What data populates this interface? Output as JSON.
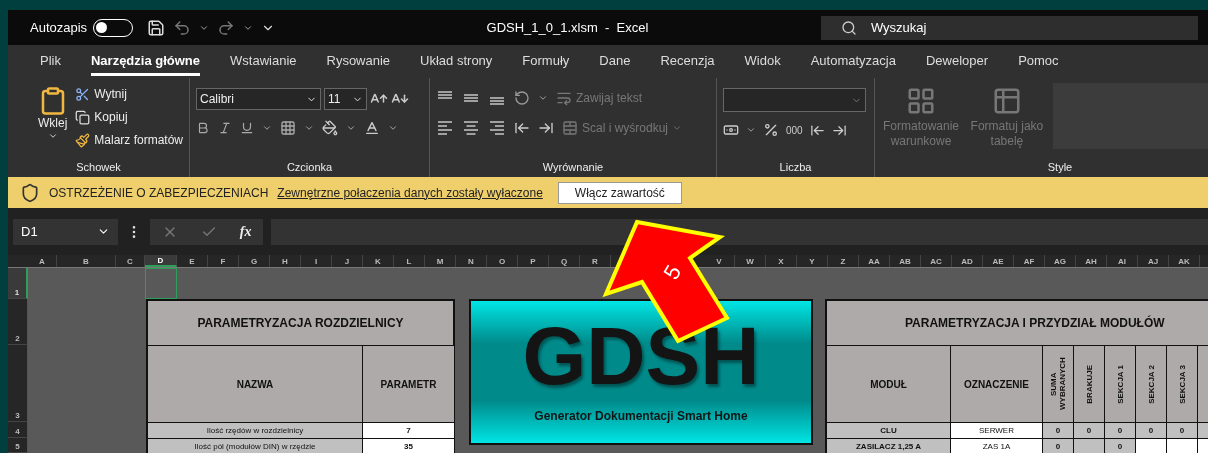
{
  "titlebar": {
    "autosave_label": "Autozapis",
    "autosave_on": false,
    "title": "GDSH_1_0_1.xlsm  -  Excel",
    "search_placeholder": "Wyszukaj"
  },
  "ribbon_tabs": [
    {
      "label": "Plik",
      "selected": false
    },
    {
      "label": "Narzędzia główne",
      "selected": true
    },
    {
      "label": "Wstawianie",
      "selected": false
    },
    {
      "label": "Rysowanie",
      "selected": false
    },
    {
      "label": "Układ strony",
      "selected": false
    },
    {
      "label": "Formuły",
      "selected": false
    },
    {
      "label": "Dane",
      "selected": false
    },
    {
      "label": "Recenzja",
      "selected": false
    },
    {
      "label": "Widok",
      "selected": false
    },
    {
      "label": "Automatyzacja",
      "selected": false
    },
    {
      "label": "Deweloper",
      "selected": false
    },
    {
      "label": "Pomoc",
      "selected": false
    }
  ],
  "ribbon": {
    "groups": [
      "Schowek",
      "Czcionka",
      "Wyrównanie",
      "Liczba",
      "Style"
    ],
    "paste_label": "Wklej",
    "clipboard_items": [
      {
        "label": "Wytnij",
        "disabled": false
      },
      {
        "label": "Kopiuj",
        "disabled": false
      },
      {
        "label": "Malarz formatów",
        "disabled": false
      }
    ],
    "font_name": "Calibri",
    "font_size": "11",
    "wrap_text": {
      "label": "Zawijaj tekst",
      "disabled": true
    },
    "merge": {
      "label": "Scal i wyśrodkuj",
      "disabled": true
    },
    "thousands_label": "000",
    "styles": [
      {
        "label": "Formatowanie warunkowe",
        "disabled": true
      },
      {
        "label": "Formatuj jako tabelę",
        "disabled": true
      }
    ]
  },
  "security_bar": {
    "title": "OSTRZEŻENIE O ZABEZPIECZENIACH",
    "message": "Zewnętrzne połaczenia danych zostały wyłaczone",
    "button": "Włącz zawartość"
  },
  "formula_bar": {
    "name_box": "D1",
    "function_label": "fx"
  },
  "sheet": {
    "columns": [
      {
        "label": "A",
        "selected": false
      },
      {
        "label": "B",
        "selected": false
      },
      {
        "label": "C",
        "selected": false
      },
      {
        "label": "D",
        "selected": true
      },
      {
        "label": "E",
        "selected": false
      },
      {
        "label": "F",
        "selected": false
      },
      {
        "label": "G",
        "selected": false
      },
      {
        "label": "H",
        "selected": false
      },
      {
        "label": "I",
        "selected": false
      },
      {
        "label": "J",
        "selected": false
      },
      {
        "label": "K",
        "selected": false
      },
      {
        "label": "L",
        "selected": false
      },
      {
        "label": "M",
        "selected": false
      },
      {
        "label": "N",
        "selected": false
      },
      {
        "label": "O",
        "selected": false
      },
      {
        "label": "P",
        "selected": false
      },
      {
        "label": "Q",
        "selected": false
      },
      {
        "label": "R",
        "selected": false
      }
    ],
    "columns_after_callout": [
      {
        "label": "V",
        "selected": false
      },
      {
        "label": "W",
        "selected": false
      },
      {
        "label": "X",
        "selected": false
      },
      {
        "label": "Y",
        "selected": false
      },
      {
        "label": "Z",
        "selected": false
      },
      {
        "label": "AA",
        "selected": false
      },
      {
        "label": "AB",
        "selected": false
      },
      {
        "label": "AC",
        "selected": false
      },
      {
        "label": "AD",
        "selected": false
      },
      {
        "label": "AE",
        "selected": false
      },
      {
        "label": "AF",
        "selected": false
      },
      {
        "label": "AG",
        "selected": false
      },
      {
        "label": "AH",
        "selected": false
      },
      {
        "label": "AI",
        "selected": false
      },
      {
        "label": "AJ",
        "selected": false
      },
      {
        "label": "AK",
        "selected": false
      }
    ],
    "rows": [
      {
        "label": "1",
        "selected": true
      },
      {
        "label": "2",
        "selected": false
      },
      {
        "label": "3",
        "selected": false
      },
      {
        "label": "4",
        "selected": false
      },
      {
        "label": "5",
        "selected": false
      }
    ],
    "left_table": {
      "title": "PARAMETRYZACJA ROZDZIELNICY",
      "columns": [
        "NAZWA",
        "PARAMETR"
      ],
      "rows": [
        [
          "Ilość rzędów w rozdzielnicy",
          "7"
        ],
        [
          "Ilość pól (modułów DIN) w rzędzie",
          "35"
        ]
      ]
    },
    "logo": {
      "title": "GDSH",
      "subtitle": "Generator Dokumentacji Smart Home"
    },
    "right_table": {
      "title": "PARAMETRYZACJA I PRZYDZIAŁ MODUŁÓW",
      "columns": [
        "MODUŁ",
        "OZNACZENIE",
        "SUMA WYBRANYCH",
        "BRAKUJE",
        "SEKCJA 1",
        "SEKCJA 2",
        "SEKCJA 3"
      ],
      "rows": [
        [
          "CLU",
          "SERWER",
          "0",
          "0",
          "0",
          "0",
          "0"
        ],
        [
          "ZASILACZ 1,25 A",
          "ZAS 1A",
          "0",
          null,
          "0",
          null,
          null
        ]
      ]
    }
  },
  "callout": {
    "label": "5"
  }
}
